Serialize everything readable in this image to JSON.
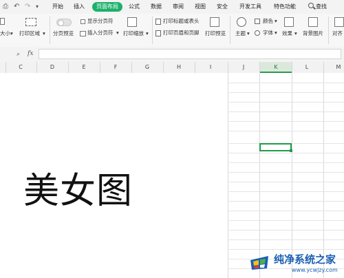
{
  "menubar": {
    "tabs": [
      "开始",
      "插入",
      "页面布局",
      "公式",
      "数据",
      "审阅",
      "视图",
      "安全",
      "开发工具",
      "特色功能"
    ],
    "active_tab": "页面布局",
    "search_label": "查找"
  },
  "ribbon": {
    "size_label": "大小",
    "print_area_label": "打印区域",
    "page_break_preview_label": "分页预览",
    "show_page_break_label": "显示分页符",
    "insert_page_break_label": "插入分页符",
    "print_scale_label": "打印缩放",
    "print_titles_label": "打印标题或表头",
    "print_header_footer_label": "打印页眉和页脚",
    "print_preview_label": "打印预览",
    "theme_label": "主题",
    "colors_label": "颜色",
    "fonts_label": "字体",
    "effects_label": "效果",
    "background_label": "背景图片",
    "align_label": "对齐"
  },
  "formula_bar": {
    "fx_label": "fx",
    "value": ""
  },
  "columns": [
    "C",
    "D",
    "E",
    "F",
    "G",
    "H",
    "I",
    "J",
    "K",
    "L",
    "M"
  ],
  "selected_column": "K",
  "sheet": {
    "big_text": "美女图"
  },
  "watermark": {
    "title": "纯净系统之家",
    "url": "www.ycwjzy.com"
  },
  "colors": {
    "accent": "#1db16b",
    "selection": "#1f9b48",
    "watermark": "#1a5fb4"
  }
}
